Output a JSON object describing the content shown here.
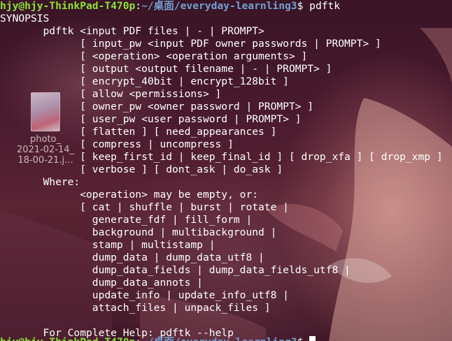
{
  "prompt": {
    "user_host": "hjy@hjy-ThinkPad-T470p",
    "separator": ":",
    "path": "~/桌面/everyday-learnling3",
    "symbol": "$",
    "command": " pdftk"
  },
  "output_lines": [
    "SYNOPSIS",
    "       pdftk <input PDF files | - | PROMPT>",
    "             [ input_pw <input PDF owner passwords | PROMPT> ]",
    "             [ <operation> <operation arguments> ]",
    "             [ output <output filename | - | PROMPT> ]",
    "             [ encrypt_40bit | encrypt_128bit ]",
    "             [ allow <permissions> ]",
    "             [ owner_pw <owner password | PROMPT> ]",
    "             [ user_pw <user password | PROMPT> ]",
    "             [ flatten ] [ need_appearances ]",
    "             [ compress | uncompress ]",
    "             [ keep_first_id | keep_final_id ] [ drop_xfa ] [ drop_xmp ]",
    "             [ verbose ] [ dont_ask | do_ask ]",
    "       Where:",
    "             <operation> may be empty, or:",
    "             [ cat | shuffle | burst | rotate |",
    "               generate_fdf | fill_form |",
    "               background | multibackground |",
    "               stamp | multistamp |",
    "               dump_data | dump_data_utf8 |",
    "               dump_data_fields | dump_data_fields_utf8 |",
    "               dump_data_annots |",
    "               update_info | update_info_utf8 |",
    "               attach_files | unpack_files ]",
    "",
    "       For Complete Help: pdftk --help"
  ],
  "desktop_icon": {
    "name": "photo-image-icon",
    "label_lines": [
      "photo_",
      "2021-02-14_",
      "18-00-21.j..."
    ]
  },
  "colors": {
    "prompt_user": "#8ae234",
    "prompt_path": "#729fcf",
    "text": "#ffffff"
  }
}
